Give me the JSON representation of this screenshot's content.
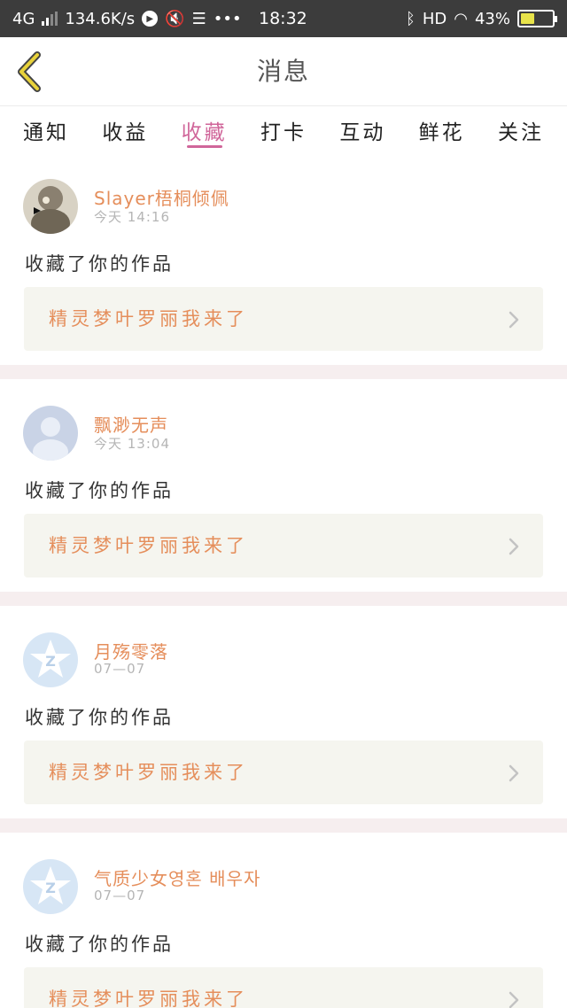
{
  "status_bar": {
    "network": "4G",
    "speed": "134.6K/s",
    "time": "18:32",
    "hd": "HD",
    "battery": "43%",
    "battery_level": 0.43,
    "dots": "•••"
  },
  "header": {
    "title": "消息"
  },
  "tabs": [
    {
      "label": "通知",
      "active": false
    },
    {
      "label": "收益",
      "active": false
    },
    {
      "label": "收藏",
      "active": true
    },
    {
      "label": "打卡",
      "active": false
    },
    {
      "label": "互动",
      "active": false
    },
    {
      "label": "鲜花",
      "active": false
    },
    {
      "label": "关注",
      "active": false
    }
  ],
  "messages": [
    {
      "name": "Slayer梧桐倾佩",
      "time": "今天 14:16",
      "action": "收藏了你的作品",
      "work": "精灵梦叶罗丽我来了",
      "avatar": "photo-avatar"
    },
    {
      "name": "飘渺无声",
      "time": "今天 13:04",
      "action": "收藏了你的作品",
      "work": "精灵梦叶罗丽我来了",
      "avatar": "default-person-avatar"
    },
    {
      "name": "月殇零落",
      "time": "07—07",
      "action": "收藏了你的作品",
      "work": "精灵梦叶罗丽我来了",
      "avatar": "qzone-star-avatar"
    },
    {
      "name": "气质少女영혼 배우자",
      "time": "07—07",
      "action": "收藏了你的作品",
      "work": "精灵梦叶罗丽我来了",
      "avatar": "qzone-star-avatar"
    }
  ],
  "colors": {
    "accent": "#d0669a",
    "name_orange": "#e58e5b",
    "card_bg": "#f5f5ef",
    "separator": "#f6eeef",
    "status_bar": "#3c3c3c"
  }
}
